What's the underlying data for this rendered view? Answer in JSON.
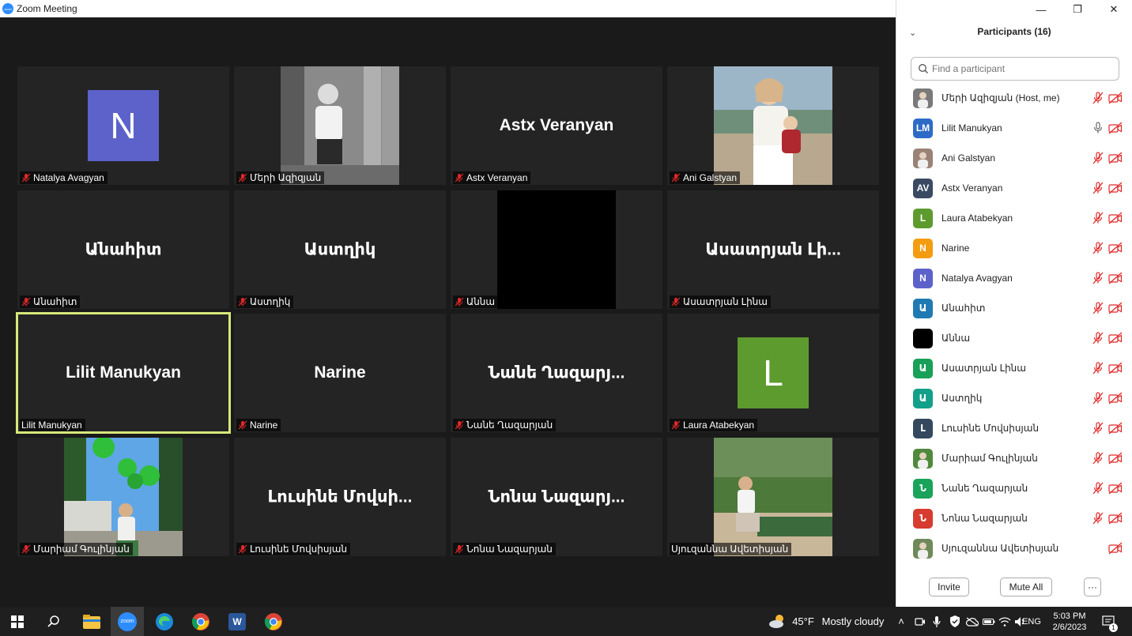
{
  "window": {
    "title": "Zoom Meeting",
    "logo_text": "zoom",
    "controls": [
      "—",
      "❐",
      "✕"
    ]
  },
  "gallery": {
    "tiles": [
      {
        "id": "t1",
        "display": "avatar",
        "avatar_letter": "N",
        "avatar_color": "#5c62c9",
        "label": "Natalya Avagyan",
        "muted": true
      },
      {
        "id": "t2",
        "display": "photo",
        "photo": "bw-woman-ruins",
        "label": "Մերի Ազիզյան",
        "muted": true
      },
      {
        "id": "t3",
        "display": "name",
        "big_name": "Astx Veranyan",
        "label": "Astx Veranyan",
        "muted": true
      },
      {
        "id": "t4",
        "display": "photo",
        "photo": "woman-with-baby",
        "label": "Ani Galstyan",
        "muted": true
      },
      {
        "id": "t5",
        "display": "name",
        "big_name": "Անահիտ",
        "label": "Անահիտ",
        "muted": true
      },
      {
        "id": "t6",
        "display": "name",
        "big_name": "Աստղիկ",
        "label": "Աստղիկ",
        "muted": true
      },
      {
        "id": "t7",
        "display": "black-video",
        "label": "Աննա",
        "muted": true
      },
      {
        "id": "t8",
        "display": "name",
        "big_name": "Ասատրյան Լի...",
        "label": "Ասատրյան Լինա",
        "muted": true
      },
      {
        "id": "t9",
        "display": "name",
        "big_name": "Lilit Manukyan",
        "label": "Lilit Manukyan",
        "muted": false,
        "active_speaker": true
      },
      {
        "id": "t10",
        "display": "name",
        "big_name": "Narine",
        "label": "Narine",
        "muted": true
      },
      {
        "id": "t11",
        "display": "name",
        "big_name": "Նանե Ղազարյ...",
        "label": "Նանե Ղազարյան",
        "muted": true
      },
      {
        "id": "t12",
        "display": "avatar",
        "avatar_letter": "L",
        "avatar_color": "#5d9b2f",
        "label": "Laura Atabekyan",
        "muted": true
      },
      {
        "id": "t13",
        "display": "photo",
        "photo": "girl-green-balloons",
        "label": "Մարիամ Գուլինյան",
        "muted": true
      },
      {
        "id": "t14",
        "display": "name",
        "big_name": "Լուսինե Մովսի...",
        "label": "Լուսինե Մովսիսյան",
        "muted": true
      },
      {
        "id": "t15",
        "display": "name",
        "big_name": "Նոնա Նազարյ...",
        "label": "Նոնա Նազարյան",
        "muted": true
      },
      {
        "id": "t16",
        "display": "photo",
        "photo": "girl-garden-bench",
        "label": "Սյուզաննա Ավետիսյան",
        "muted": false
      }
    ]
  },
  "panel": {
    "title": "Participants (16)",
    "search_placeholder": "Find a participant",
    "participants": [
      {
        "name": "Մերի Ազիզյան (Host, me)",
        "avatar": "photo",
        "photo_color": "#7a7a7a",
        "mic": "muted",
        "video": "off"
      },
      {
        "name": "Lilit Manukyan",
        "avatar": "initials",
        "initials": "LM",
        "color": "#2e6bc6",
        "mic": "on",
        "video": "off"
      },
      {
        "name": "Ani Galstyan",
        "avatar": "photo",
        "photo_color": "#9a8276",
        "mic": "muted",
        "video": "off"
      },
      {
        "name": "Astx Veranyan",
        "avatar": "initials",
        "initials": "AV",
        "color": "#3a4a63",
        "mic": "muted",
        "video": "off"
      },
      {
        "name": "Laura Atabekyan",
        "avatar": "initials",
        "initials": "L",
        "color": "#5d9b2f",
        "mic": "muted",
        "video": "off"
      },
      {
        "name": "Narine",
        "avatar": "initials",
        "initials": "N",
        "color": "#f39c12",
        "mic": "muted",
        "video": "off"
      },
      {
        "name": "Natalya Avagyan",
        "avatar": "initials",
        "initials": "N",
        "color": "#5c62c9",
        "mic": "muted",
        "video": "off"
      },
      {
        "name": "Անահիտ",
        "avatar": "initials",
        "initials": "Ա",
        "color": "#1f7ab3",
        "mic": "muted",
        "video": "off"
      },
      {
        "name": "Աննա",
        "avatar": "initials",
        "initials": "",
        "color": "#000000",
        "mic": "muted",
        "video": "off"
      },
      {
        "name": "Ասատրյան Լինա",
        "avatar": "initials",
        "initials": "Ա",
        "color": "#18a058",
        "mic": "muted",
        "video": "off"
      },
      {
        "name": "Աստղիկ",
        "avatar": "initials",
        "initials": "Ա",
        "color": "#13a08a",
        "mic": "muted",
        "video": "off"
      },
      {
        "name": "Լուսինե Մովսիսյան",
        "avatar": "initials",
        "initials": "Լ",
        "color": "#34495e",
        "mic": "muted",
        "video": "off"
      },
      {
        "name": "Մարիամ Գուլինյան",
        "avatar": "photo",
        "photo_color": "#4f8a3c",
        "mic": "muted",
        "video": "off"
      },
      {
        "name": "Նանե Ղազարյան",
        "avatar": "initials",
        "initials": "Ն",
        "color": "#1aa35b",
        "mic": "muted",
        "video": "off"
      },
      {
        "name": "Նոնա Նազարյան",
        "avatar": "initials",
        "initials": "Ն",
        "color": "#d63c2f",
        "mic": "muted",
        "video": "off"
      },
      {
        "name": "Սյուզաննա Ավետիսյան",
        "avatar": "photo",
        "photo_color": "#6f8a5a",
        "mic": "none",
        "video": "off"
      }
    ],
    "invite_label": "Invite",
    "mute_all_label": "Mute All",
    "more_label": "···"
  },
  "taskbar": {
    "weather_temp": "45°F",
    "weather_text": "Mostly cloudy",
    "lang": "ENG",
    "time": "5:03 PM",
    "date": "2/6/2023",
    "notif_count": "1",
    "zoom_label": "zoom",
    "word_label": "W"
  },
  "colors": {
    "muted_red": "#e02828",
    "active_border": "#d6e87a",
    "tile_bg": "#242424"
  }
}
